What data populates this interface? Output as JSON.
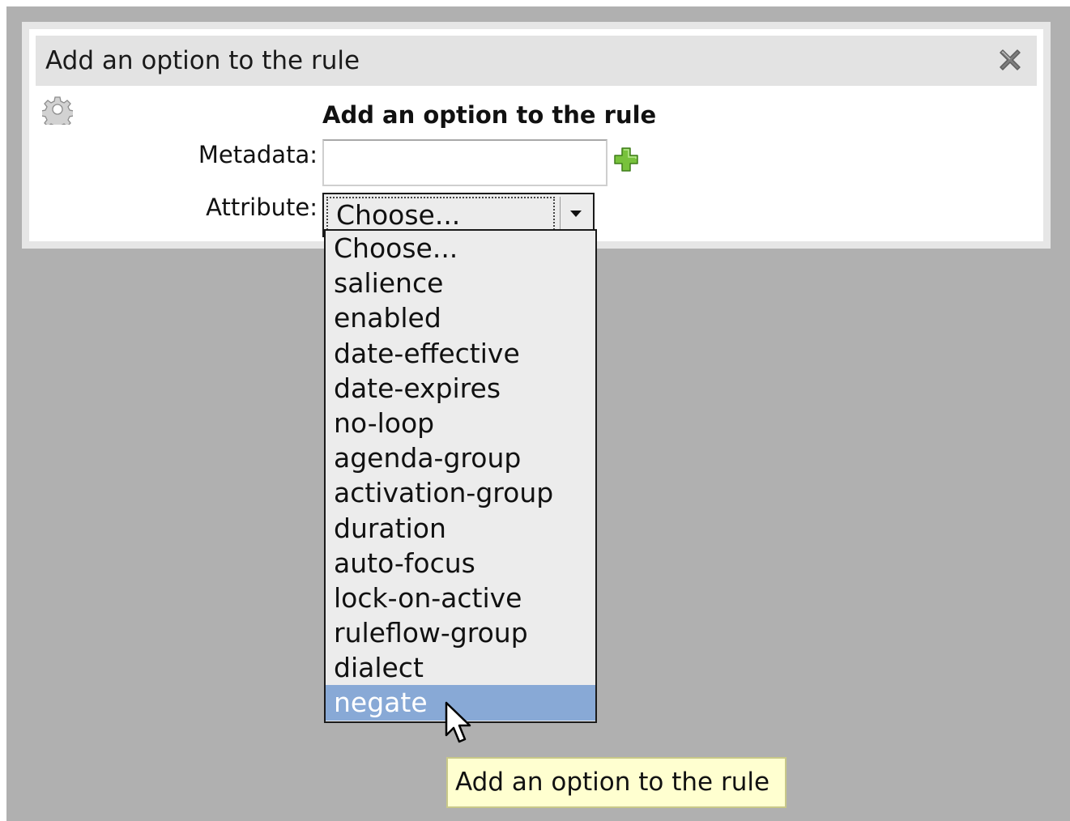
{
  "dialog": {
    "title": "Add an option to the rule",
    "heading": "Add an option to the rule"
  },
  "form": {
    "metadata_label": "Metadata:",
    "metadata_value": "",
    "attribute_label": "Attribute:",
    "attribute_selected": "Choose..."
  },
  "dropdown": {
    "options": [
      "Choose...",
      "salience",
      "enabled",
      "date-effective",
      "date-expires",
      "no-loop",
      "agenda-group",
      "activation-group",
      "duration",
      "auto-focus",
      "lock-on-active",
      "ruleflow-group",
      "dialect",
      "negate"
    ],
    "highlighted": "negate"
  },
  "tooltip": {
    "text": "Add an option to the rule"
  },
  "colors": {
    "highlight": "#88a9d6",
    "tooltip_bg": "#ffffd0",
    "add_icon": "#5aa82a",
    "backdrop": "#b0b0b0"
  },
  "icons": [
    "close-icon",
    "gear-icon",
    "add-icon",
    "dropdown-arrow-icon",
    "mouse-cursor-icon"
  ]
}
